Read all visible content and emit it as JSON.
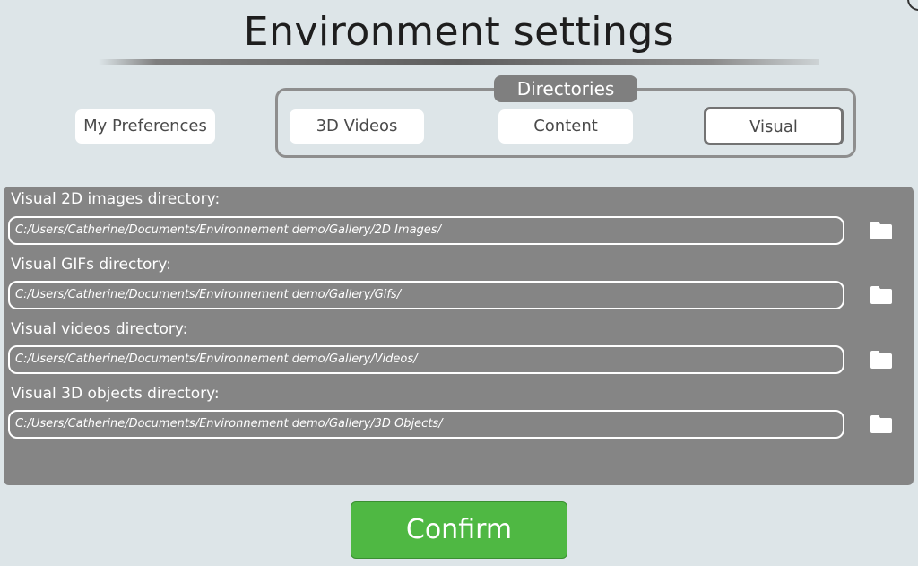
{
  "title": "Environment settings",
  "tabs": {
    "preferences": "My Preferences",
    "group_label": "Directories",
    "videos_3d": "3D Videos",
    "content": "Content",
    "visual": "Visual"
  },
  "active_tab": "Visual",
  "fields": [
    {
      "label": "Visual 2D images directory:",
      "value": "C:/Users/Catherine/Documents/Environnement demo/Gallery/2D Images/"
    },
    {
      "label": "Visual GIFs directory:",
      "value": "C:/Users/Catherine/Documents/Environnement demo/Gallery/Gifs/"
    },
    {
      "label": "Visual videos directory:",
      "value": "C:/Users/Catherine/Documents/Environnement demo/Gallery/Videos/"
    },
    {
      "label": "Visual 3D objects directory:",
      "value": "C:/Users/Catherine/Documents/Environnement demo/Gallery/3D Objects/"
    }
  ],
  "icons": {
    "browse": "folder-icon"
  },
  "confirm_label": "Confirm",
  "colors": {
    "background": "#dde5e8",
    "panel": "#858585",
    "confirm": "#4fb843",
    "active_tab_border": "#737373"
  }
}
